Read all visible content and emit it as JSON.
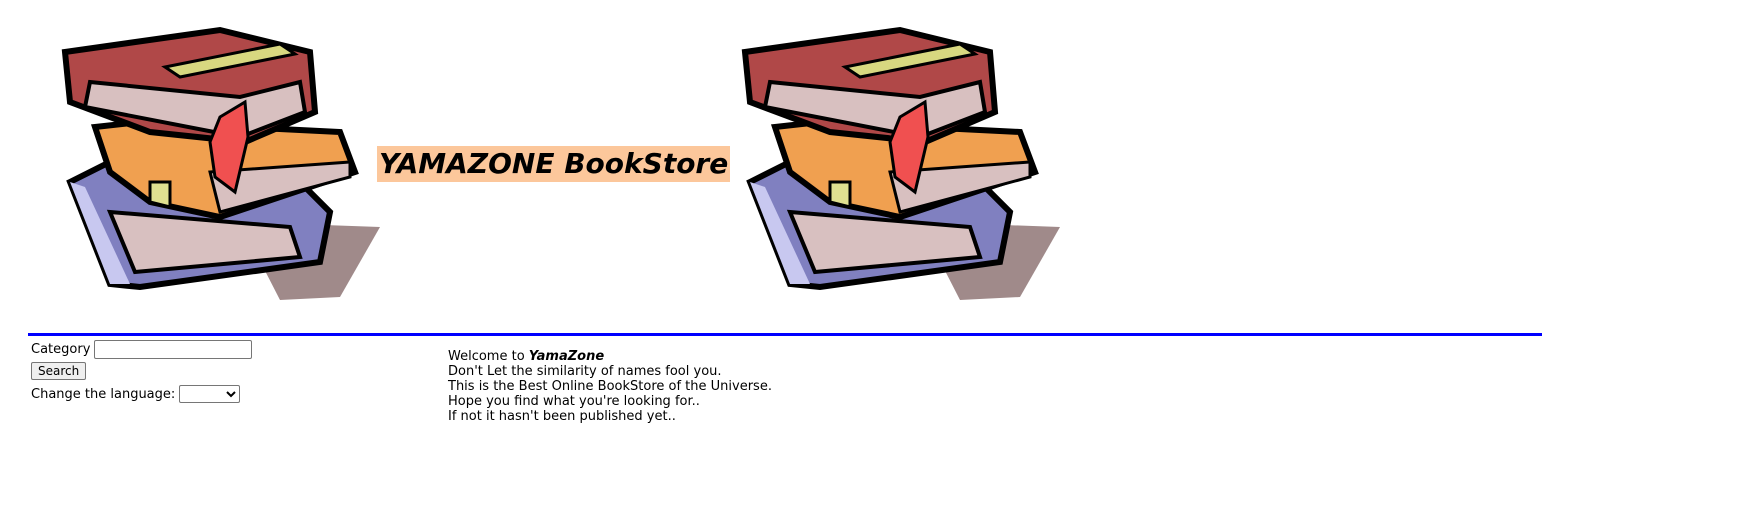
{
  "header": {
    "title": "YAMAZONE BookStore",
    "logo_icon": "book-stack-icon"
  },
  "colors": {
    "title_bg": "#fcc79b",
    "rule": "#0000ff"
  },
  "search": {
    "category_label": "Category",
    "category_value": "",
    "search_button": "Search",
    "language_label": "Change the language:",
    "language_value": ""
  },
  "welcome": {
    "prefix": "Welcome to ",
    "brand": "YamaZone",
    "lines": [
      "Don't Let the similarity of names fool you.",
      "This is the Best Online BookStore of the Universe.",
      "Hope you find what you're looking for..",
      "If not it hasn't been published yet.."
    ]
  }
}
